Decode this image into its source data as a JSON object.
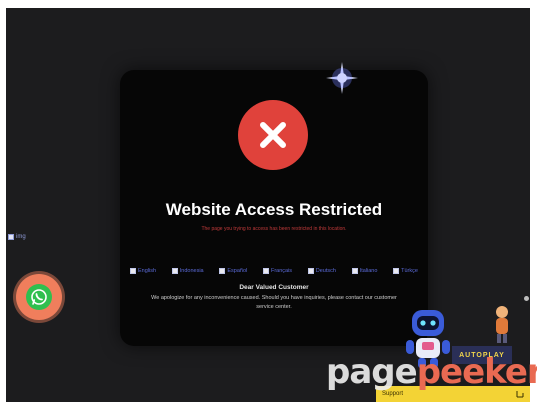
{
  "modal": {
    "title": "Website Access Restricted",
    "subtitle": "The page you trying to access has been restricted in this location.",
    "languages": [
      "English",
      "Indonesia",
      "Español",
      "Français",
      "Deutsch",
      "Italiano",
      "Türkçe"
    ],
    "greeting": "Dear Valued Customer",
    "message": "We apologize for any inconvenience caused. Should you have inquiries, please contact our customer service center."
  },
  "broken_image_alt": "img",
  "promo_label": "AUTOPLAY",
  "bottom_bar": {
    "label": "Support"
  },
  "watermark": {
    "part1": "page",
    "part2": "peeker"
  },
  "colors": {
    "background": "#1c1c1e",
    "modal": "#060606",
    "error_red": "#e0423b",
    "whatsapp_ring": "#f07e5c",
    "whatsapp": "#2fbf4f",
    "bar": "#f3d335"
  },
  "icons": [
    "close-x-icon",
    "sparkle-icon",
    "whatsapp-icon",
    "robot-mascot-icon",
    "mascot-icon"
  ]
}
